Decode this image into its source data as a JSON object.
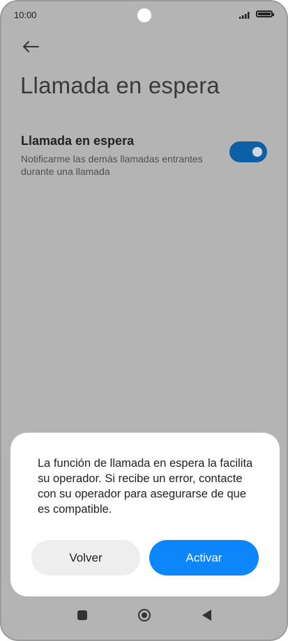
{
  "status_bar": {
    "time": "10:00"
  },
  "page": {
    "title": "Llamada en espera"
  },
  "setting": {
    "title": "Llamada en espera",
    "description": "Notificarme las demás llamadas entrantes durante una llamada",
    "enabled": true
  },
  "dialog": {
    "message": "La función de llamada en espera la facilita su operador. Si recibe un error, contacte con su operador para asegurarse de que es compatible.",
    "cancel_label": "Volver",
    "confirm_label": "Activar"
  },
  "colors": {
    "accent": "#0e86fb",
    "toggle_on": "#0d5fa6",
    "background_dim": "#b4b4b4"
  },
  "icons": {
    "back": "arrow-left-icon",
    "nav_recent": "square-icon",
    "nav_home": "circle-icon",
    "nav_back": "triangle-back-icon"
  }
}
